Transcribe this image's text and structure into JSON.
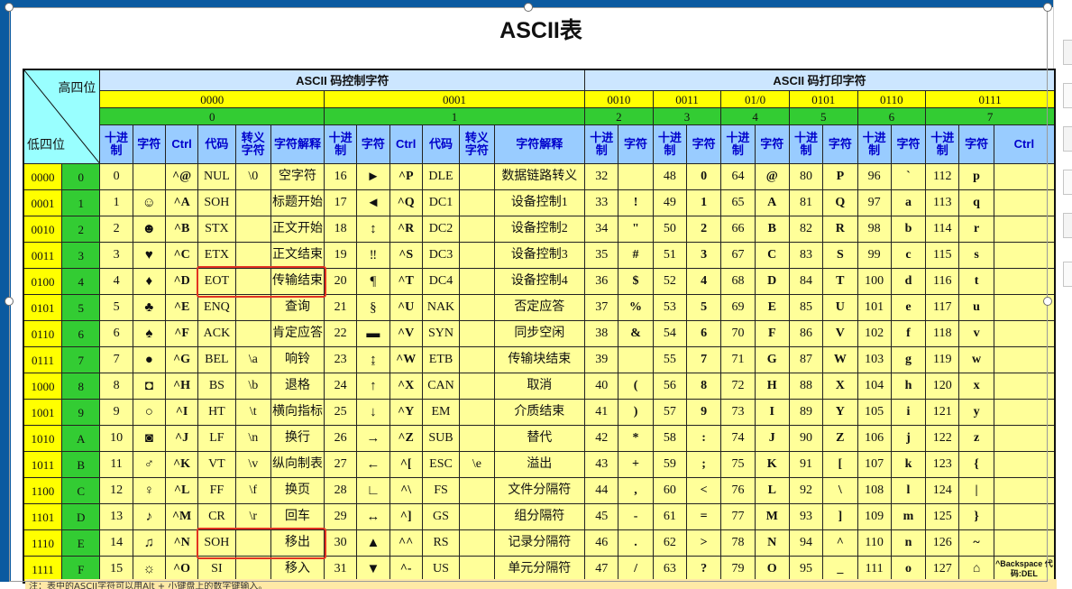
{
  "title": "ASCII表",
  "header": {
    "corner_high": "高四位",
    "corner_low": "低四位",
    "group_control": "ASCII 码控制字符",
    "group_print": "ASCII 码打印字符",
    "bin": [
      "0000",
      "0001",
      "0010",
      "0011",
      "01/0",
      "0101",
      "0110",
      "0111"
    ],
    "dec": [
      "0",
      "1",
      "2",
      "3",
      "4",
      "5",
      "6",
      "7"
    ],
    "sub_control": [
      "十进制",
      "字符",
      "Ctrl",
      "代码",
      "转义字符",
      "字符解释"
    ],
    "sub_print": [
      "十进制",
      "字符"
    ],
    "sub_last_ctrl": "Ctrl"
  },
  "rows": [
    {
      "bin": "0000",
      "hex": "0",
      "c0": [
        "0",
        "",
        "^@",
        "NUL",
        "\\0",
        "空字符"
      ],
      "c1": [
        "16",
        "►",
        "^P",
        "DLE",
        "",
        "数据链路转义"
      ],
      "p": [
        [
          "32",
          ""
        ],
        [
          "48",
          "0"
        ],
        [
          "64",
          "@"
        ],
        [
          "80",
          "P"
        ],
        [
          "96",
          "`"
        ],
        [
          "112",
          "p"
        ]
      ],
      "last": ""
    },
    {
      "bin": "0001",
      "hex": "1",
      "c0": [
        "1",
        "☺",
        "^A",
        "SOH",
        "",
        "标题开始"
      ],
      "c1": [
        "17",
        "◄",
        "^Q",
        "DC1",
        "",
        "设备控制1"
      ],
      "p": [
        [
          "33",
          "!"
        ],
        [
          "49",
          "1"
        ],
        [
          "65",
          "A"
        ],
        [
          "81",
          "Q"
        ],
        [
          "97",
          "a"
        ],
        [
          "113",
          "q"
        ]
      ],
      "last": ""
    },
    {
      "bin": "0010",
      "hex": "2",
      "c0": [
        "2",
        "☻",
        "^B",
        "STX",
        "",
        "正文开始"
      ],
      "c1": [
        "18",
        "↕",
        "^R",
        "DC2",
        "",
        "设备控制2"
      ],
      "p": [
        [
          "34",
          "\""
        ],
        [
          "50",
          "2"
        ],
        [
          "66",
          "B"
        ],
        [
          "82",
          "R"
        ],
        [
          "98",
          "b"
        ],
        [
          "114",
          "r"
        ]
      ],
      "last": ""
    },
    {
      "bin": "0011",
      "hex": "3",
      "c0": [
        "3",
        "♥",
        "^C",
        "ETX",
        "",
        "正文结束"
      ],
      "c1": [
        "19",
        "‼",
        "^S",
        "DC3",
        "",
        "设备控制3"
      ],
      "p": [
        [
          "35",
          "#"
        ],
        [
          "51",
          "3"
        ],
        [
          "67",
          "C"
        ],
        [
          "83",
          "S"
        ],
        [
          "99",
          "c"
        ],
        [
          "115",
          "s"
        ]
      ],
      "last": ""
    },
    {
      "bin": "0100",
      "hex": "4",
      "c0": [
        "4",
        "♦",
        "^D",
        "EOT",
        "",
        "传输结束"
      ],
      "c1": [
        "20",
        "¶",
        "^T",
        "DC4",
        "",
        "设备控制4"
      ],
      "p": [
        [
          "36",
          "$"
        ],
        [
          "52",
          "4"
        ],
        [
          "68",
          "D"
        ],
        [
          "84",
          "T"
        ],
        [
          "100",
          "d"
        ],
        [
          "116",
          "t"
        ]
      ],
      "last": ""
    },
    {
      "bin": "0101",
      "hex": "5",
      "c0": [
        "5",
        "♣",
        "^E",
        "ENQ",
        "",
        "查询"
      ],
      "c1": [
        "21",
        "§",
        "^U",
        "NAK",
        "",
        "否定应答"
      ],
      "p": [
        [
          "37",
          "%"
        ],
        [
          "53",
          "5"
        ],
        [
          "69",
          "E"
        ],
        [
          "85",
          "U"
        ],
        [
          "101",
          "e"
        ],
        [
          "117",
          "u"
        ]
      ],
      "last": ""
    },
    {
      "bin": "0110",
      "hex": "6",
      "c0": [
        "6",
        "♠",
        "^F",
        "ACK",
        "",
        "肯定应答"
      ],
      "c1": [
        "22",
        "▬",
        "^V",
        "SYN",
        "",
        "同步空闲"
      ],
      "p": [
        [
          "38",
          "&"
        ],
        [
          "54",
          "6"
        ],
        [
          "70",
          "F"
        ],
        [
          "86",
          "V"
        ],
        [
          "102",
          "f"
        ],
        [
          "118",
          "v"
        ]
      ],
      "last": ""
    },
    {
      "bin": "0111",
      "hex": "7",
      "c0": [
        "7",
        "●",
        "^G",
        "BEL",
        "\\a",
        "响铃"
      ],
      "c1": [
        "23",
        "↨",
        "^W",
        "ETB",
        "",
        "传输块结束"
      ],
      "p": [
        [
          "39",
          ""
        ],
        [
          "55",
          "7"
        ],
        [
          "71",
          "G"
        ],
        [
          "87",
          "W"
        ],
        [
          "103",
          "g"
        ],
        [
          "119",
          "w"
        ]
      ],
      "last": ""
    },
    {
      "bin": "1000",
      "hex": "8",
      "c0": [
        "8",
        "◘",
        "^H",
        "BS",
        "\\b",
        "退格"
      ],
      "c1": [
        "24",
        "↑",
        "^X",
        "CAN",
        "",
        "取消"
      ],
      "p": [
        [
          "40",
          "("
        ],
        [
          "56",
          "8"
        ],
        [
          "72",
          "H"
        ],
        [
          "88",
          "X"
        ],
        [
          "104",
          "h"
        ],
        [
          "120",
          "x"
        ]
      ],
      "last": ""
    },
    {
      "bin": "1001",
      "hex": "9",
      "c0": [
        "9",
        "○",
        "^I",
        "HT",
        "\\t",
        "横向指标"
      ],
      "c1": [
        "25",
        "↓",
        "^Y",
        "EM",
        "",
        "介质结束"
      ],
      "p": [
        [
          "41",
          ")"
        ],
        [
          "57",
          "9"
        ],
        [
          "73",
          "I"
        ],
        [
          "89",
          "Y"
        ],
        [
          "105",
          "i"
        ],
        [
          "121",
          "y"
        ]
      ],
      "last": ""
    },
    {
      "bin": "1010",
      "hex": "A",
      "c0": [
        "10",
        "◙",
        "^J",
        "LF",
        "\\n",
        "换行"
      ],
      "c1": [
        "26",
        "→",
        "^Z",
        "SUB",
        "",
        "替代"
      ],
      "p": [
        [
          "42",
          "*"
        ],
        [
          "58",
          ":"
        ],
        [
          "74",
          "J"
        ],
        [
          "90",
          "Z"
        ],
        [
          "106",
          "j"
        ],
        [
          "122",
          "z"
        ]
      ],
      "last": ""
    },
    {
      "bin": "1011",
      "hex": "B",
      "c0": [
        "11",
        "♂",
        "^K",
        "VT",
        "\\v",
        "纵向制表"
      ],
      "c1": [
        "27",
        "←",
        "^[",
        "ESC",
        "\\e",
        "溢出"
      ],
      "p": [
        [
          "43",
          "+"
        ],
        [
          "59",
          ";"
        ],
        [
          "75",
          "K"
        ],
        [
          "91",
          "["
        ],
        [
          "107",
          "k"
        ],
        [
          "123",
          "{"
        ]
      ],
      "last": ""
    },
    {
      "bin": "1100",
      "hex": "C",
      "c0": [
        "12",
        "♀",
        "^L",
        "FF",
        "\\f",
        "换页"
      ],
      "c1": [
        "28",
        "∟",
        "^\\",
        "FS",
        "",
        "文件分隔符"
      ],
      "p": [
        [
          "44",
          ","
        ],
        [
          "60",
          "<"
        ],
        [
          "76",
          "L"
        ],
        [
          "92",
          "\\"
        ],
        [
          "108",
          "l"
        ],
        [
          "124",
          "|"
        ]
      ],
      "last": ""
    },
    {
      "bin": "1101",
      "hex": "D",
      "c0": [
        "13",
        "♪",
        "^M",
        "CR",
        "\\r",
        "回车"
      ],
      "c1": [
        "29",
        "↔",
        "^]",
        "GS",
        "",
        "组分隔符"
      ],
      "p": [
        [
          "45",
          "-"
        ],
        [
          "61",
          "="
        ],
        [
          "77",
          "M"
        ],
        [
          "93",
          "]"
        ],
        [
          "109",
          "m"
        ],
        [
          "125",
          "}"
        ]
      ],
      "last": ""
    },
    {
      "bin": "1110",
      "hex": "E",
      "c0": [
        "14",
        "♫",
        "^N",
        "SOH",
        "",
        "移出"
      ],
      "c1": [
        "30",
        "▲",
        "^^",
        "RS",
        "",
        "记录分隔符"
      ],
      "p": [
        [
          "46",
          "."
        ],
        [
          "62",
          ">"
        ],
        [
          "78",
          "N"
        ],
        [
          "94",
          "^"
        ],
        [
          "110",
          "n"
        ],
        [
          "126",
          "~"
        ]
      ],
      "last": ""
    },
    {
      "bin": "1111",
      "hex": "F",
      "c0": [
        "15",
        "☼",
        "^O",
        "SI",
        "",
        "移入"
      ],
      "c1": [
        "31",
        "▼",
        "^-",
        "US",
        "",
        "单元分隔符"
      ],
      "p": [
        [
          "47",
          "/"
        ],
        [
          "63",
          "?"
        ],
        [
          "79",
          "O"
        ],
        [
          "95",
          "_"
        ],
        [
          "111",
          "o"
        ],
        [
          "127",
          "⌂"
        ]
      ],
      "last": "^Backspace 代码:DEL"
    }
  ],
  "footer_note": "注：表中的ASCII字符可以用Alt + 小键盘上的数字键输入。",
  "colors": {
    "header_blue": "#cce6ff",
    "bin_yellow": "#ffff00",
    "dec_green": "#33cc33",
    "cell_yellow": "#ffff99",
    "highlight_red": "#e23322"
  }
}
